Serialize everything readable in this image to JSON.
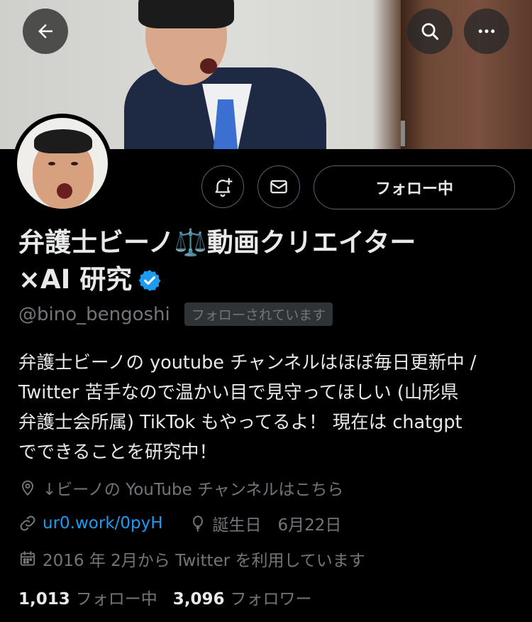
{
  "header": {
    "back_icon": "arrow-left-icon",
    "search_icon": "search-icon",
    "more_icon": "more-horizontal-icon"
  },
  "actions": {
    "notify_icon": "bell-plus-icon",
    "message_icon": "mail-icon",
    "follow_label": "フォロー中"
  },
  "profile": {
    "name_line1": "弁護士ビーノ⚖️動画クリエイター",
    "name_line2": "×AI 研究",
    "verified": true,
    "handle": "@bino_bengoshi",
    "follows_you": "フォローされています",
    "bio_lines": [
      "弁護士ビーノの youtube チャンネルはほぼ毎日更新中 /",
      "Twitter 苦手なので温かい目で見守ってほしい (山形県",
      "弁護士会所属) TikTok もやってるよ！ 現在は chatgpt",
      "でできることを研究中！"
    ],
    "location": "↓ビーノの YouTube チャンネルはこちら",
    "link": "ur0.work/0pyH",
    "birthday": "誕生日　6月22日",
    "joined": "2016 年 2月から Twitter を利用しています"
  },
  "stats": {
    "following_count": "1,013",
    "following_label": "フォロー中",
    "followers_count": "3,096",
    "followers_label": "フォロワー"
  },
  "colors": {
    "accent": "#1d9bf0",
    "muted": "#71767b",
    "background": "#000000",
    "border": "#536471"
  }
}
